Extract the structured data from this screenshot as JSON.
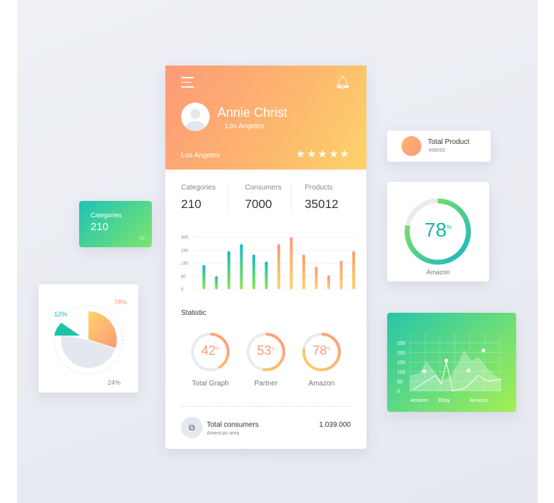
{
  "profile": {
    "name": "Annie Christ",
    "subtitle": "Los Angeles",
    "location": "Los Angeles",
    "rating": 5
  },
  "stats": [
    {
      "label": "Categories",
      "value": "210"
    },
    {
      "label": "Consumers",
      "value": "7000"
    },
    {
      "label": "Products",
      "value": "35012"
    }
  ],
  "bar_chart": {
    "type": "bar",
    "yticks": [
      "300",
      "240",
      "160",
      "80",
      "0"
    ],
    "ylim": [
      0,
      300
    ],
    "values": [
      140,
      75,
      220,
      260,
      200,
      160,
      260,
      300,
      200,
      130,
      80,
      165,
      220
    ],
    "colors": [
      "#1ab6c8",
      "#8de84a",
      "#fd9a78",
      "#fdd36a"
    ]
  },
  "statistic": {
    "title": "Statistic",
    "rings": [
      {
        "value": "42",
        "unit": "%",
        "label": "Total Graph",
        "color": "#fd9a78"
      },
      {
        "value": "53",
        "unit": "%",
        "label": "Partner",
        "color": "#fd9a78"
      },
      {
        "value": "78",
        "unit": "%",
        "label": "Amazon",
        "color": "#fd9a78"
      }
    ]
  },
  "footer": {
    "title": "Total consumers",
    "subtitle": "American area",
    "value": "1.039.000"
  },
  "categories_card": {
    "label": "Categories",
    "value": "210"
  },
  "total_product": {
    "title": "Total Product",
    "value": "456000"
  },
  "amazon_card": {
    "value": "78",
    "unit": "%",
    "label": "Amazon",
    "percent": 78
  },
  "pie": {
    "slices": [
      {
        "label": "78%",
        "value": 78
      },
      {
        "label": "12%",
        "value": 12
      },
      {
        "label": "24%",
        "value": 24
      }
    ]
  },
  "area_chart": {
    "yticks": [
      "250",
      "200",
      "150",
      "100",
      "50",
      "0"
    ],
    "xlabels": [
      "Amazon",
      "Ebay",
      "Amazon"
    ]
  }
}
